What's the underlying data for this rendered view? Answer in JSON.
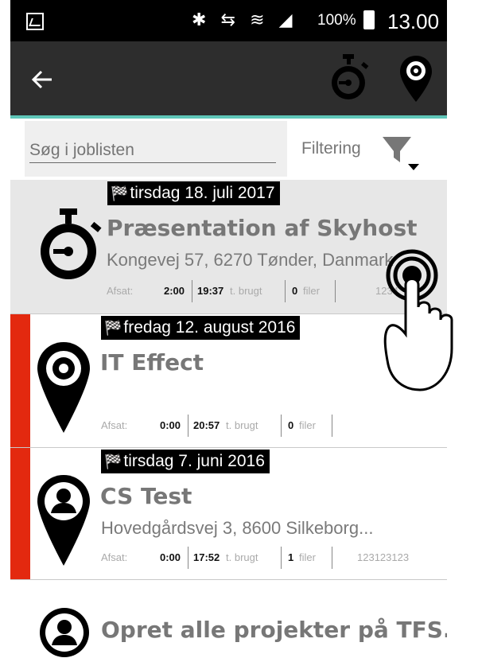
{
  "status_bar": {
    "icons": "✱ ⇆ ≋ ◢",
    "battery": "100%",
    "time": "13.00"
  },
  "toolbar": {
    "back_icon": "arrow-left-icon",
    "stopwatch_icon": "stopwatch-icon",
    "location_settings_icon": "map-pin-gear-icon",
    "accent_color": "#5fc6b8"
  },
  "search": {
    "placeholder": "Søg i joblisten",
    "value": ""
  },
  "filter": {
    "label": "Filtering"
  },
  "jobs": [
    {
      "date": "tirsdag 18. juli 2017",
      "title": "Præsentation af Skyhost",
      "address": "Kongevej 57, 6270 Tønder, Danmark",
      "afsat_label": "Afsat:",
      "afsat": "2:00",
      "brugt": "19:37",
      "brugt_label": "t. brugt",
      "filer": "0",
      "filer_label": "filer",
      "ref": "1234",
      "icon": "stopwatch-icon",
      "status_color": ""
    },
    {
      "date": "fredag 12. august 2016",
      "title": "IT Effect",
      "address": "",
      "afsat_label": "Afsat:",
      "afsat": "0:00",
      "brugt": "20:57",
      "brugt_label": "t. brugt",
      "filer": "0",
      "filer_label": "filer",
      "ref": "",
      "icon": "map-pin-gear-icon",
      "status_color": "#e3290f"
    },
    {
      "date": "tirsdag 7. juni 2016",
      "title": "CS Test",
      "address": "Hovedgårdsvej 3, 8600 Silkeborg...",
      "afsat_label": "Afsat:",
      "afsat": "0:00",
      "brugt": "17:52",
      "brugt_label": "t. brugt",
      "filer": "1",
      "filer_label": "filer",
      "ref": "123123123",
      "icon": "map-pin-person-icon",
      "status_color": "#e3290f"
    },
    {
      "title": "Opret alle projekter på TFS...",
      "icon": "person-icon"
    }
  ],
  "overlay": {
    "icon": "tap-hand-icon"
  }
}
